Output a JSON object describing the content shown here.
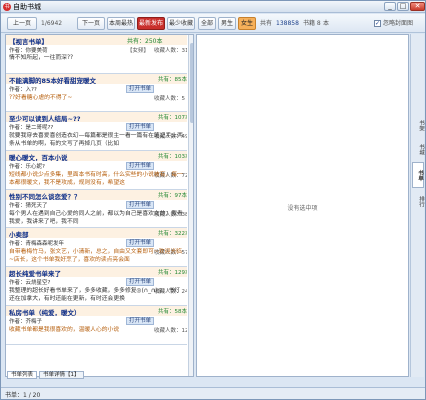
{
  "window": {
    "title": "自助书城",
    "minimize": "_",
    "maximize": "□",
    "close": "✕",
    "app_icon": "book-icon"
  },
  "toolbar": {
    "prev": "上一页",
    "page": "1/6942",
    "next": "下一页",
    "recent": "本周最热",
    "latest": "最新发布",
    "recommend": "最少收藏",
    "all": "全部",
    "male": "男生",
    "female": "女生",
    "total_label": "共有",
    "total_count": "138858",
    "unit_label": "书籍 8",
    "unit_suffix": "本",
    "check_mark": "✓",
    "checkbox_label": "忽略封面图"
  },
  "books": [
    {
      "title": "【视言书单】",
      "score": "共有：250本",
      "author": "作者：你要美荷",
      "tag": "【女频】",
      "popularity": "收藏人数：31",
      "desc": "情不知所起，一往而深??"
    },
    {
      "title": "不能满脚的85本好看甜宠暖文",
      "score": "共有：85本",
      "author": "作者：入??",
      "open": "打开书单",
      "score2": "收藏人数：5",
      "desc": "??好看糖心虐的不得了~"
    },
    {
      "title": "至少可以读到人结局~??",
      "score": "共有：107本",
      "author": "作者：是二哥呢??",
      "open": "打开书单",
      "score2": "收藏人数：49",
      "desc": "就要我穿去喜爱喜创造衣幻—每篇都是很主一看一篇有在笔记手上两条从书单的啊，有的文写了再掉几页（比如"
    },
    {
      "title": "暖心暖文，百本小说",
      "score": "共有：103本",
      "author": "作者：乐心妮?",
      "open": "打开书单",
      "score2": "收藏人数：72",
      "desc": "短线都小说少点多集，里面本书有时高，什么实些的小说被有，每一本都很暖文，我不是攻成，规则没有，希望这"
    },
    {
      "title": "性别不同怎么谈恋爱？？",
      "score": "共有：97本",
      "author": "作者：猜死天了",
      "open": "打开书单",
      "score2": "收藏人数：38",
      "desc": "每个男人在遇到自己心爱的同人之前，都以为自己是喜欢女的；我看我爱，我讲来了吧，我不同"
    },
    {
      "title": "小卖部",
      "score": "共有：322本",
      "author": "作者：青梅森森呢发年",
      "open": "打开书单",
      "score2": "收藏人数：57",
      "desc": "自带看梅竹马，张文艺，小清新，总之，自由又文套即可~欢迎光临~店长，这个书单我好烹了，喜欢的读点亮会面"
    },
    {
      "title": "超长纯爱书单来了",
      "score": "共有：129本",
      "author": "作者：云烧星空?",
      "open": "打开书单",
      "score2": "收藏人数：24",
      "desc": "我整理的超长好看书单来了，多多收藏，多多修复◎(∩_∩)◎，书灯还在加拿大，有时还能在更新，有时还会更换"
    },
    {
      "title": "私房书单（纯爱，暖文）",
      "score": "共有：58本",
      "author": "作者：芥梅子",
      "open": "打开书单",
      "score2": "收藏人数：12",
      "desc": "收藏书单都是我很喜欢的，温暖人心的小说"
    }
  ],
  "empty_text": "没有选中项",
  "side_tabs": [
    "书架",
    "书城",
    "书单",
    "排行"
  ],
  "bottom_tabs": [
    "书单列表",
    "书单详情【1】"
  ],
  "status": "书单：1 / 20"
}
